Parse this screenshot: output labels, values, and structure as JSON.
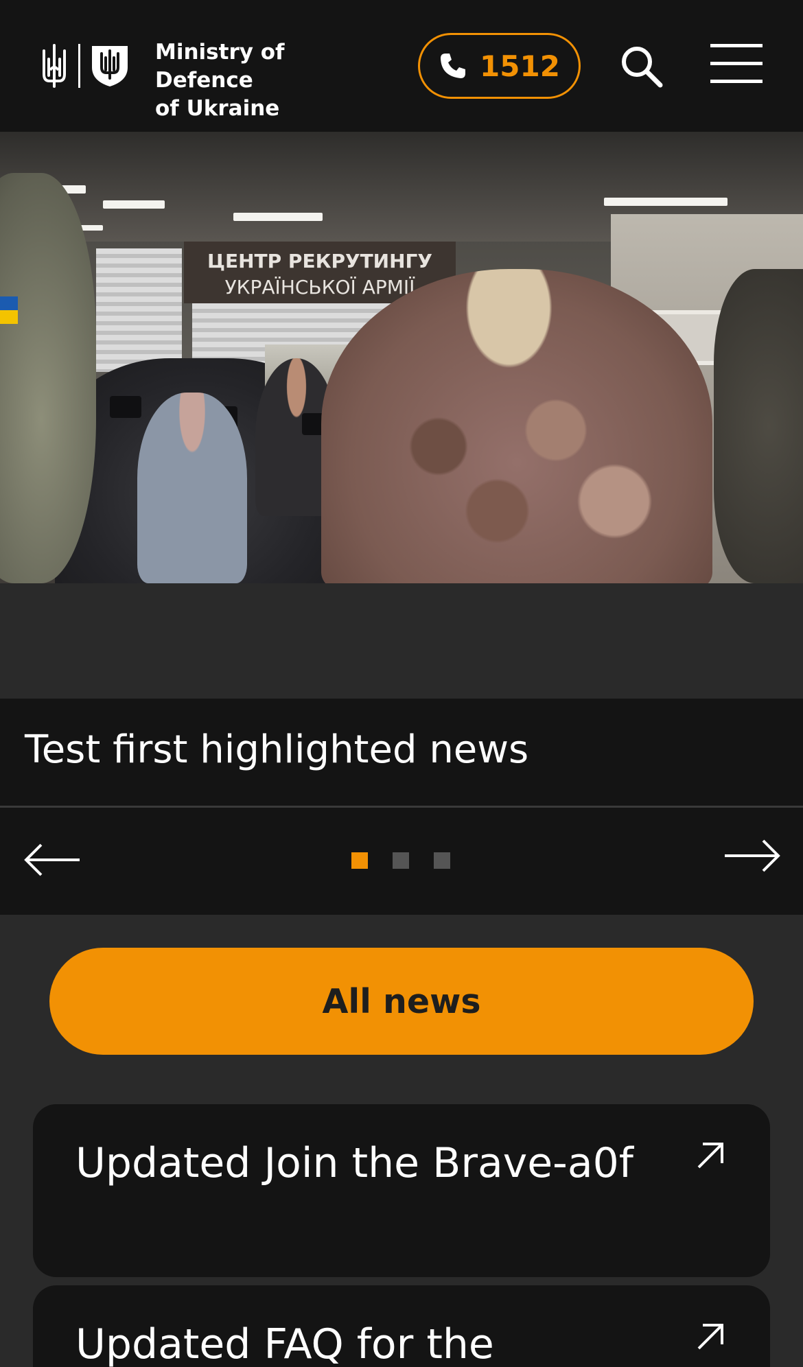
{
  "header": {
    "brand_line1": "Ministry of Defence",
    "brand_line2": "of Ukraine",
    "phone_number": "1512",
    "logo_icons": [
      "trident-icon",
      "shield-icon"
    ]
  },
  "hero": {
    "sign_line1": "ЦЕНТР РЕКРУТИНГУ",
    "sign_line2": "УКРАЇНСЬКОЇ АРМІЇ"
  },
  "slider": {
    "title": "Test first highlighted news",
    "slides_total": 3,
    "active_slide": 1
  },
  "all_news_label": "All news",
  "cards": [
    {
      "title": "Updated Join the Brave-a0f"
    },
    {
      "title": "Updated FAQ for the"
    }
  ],
  "colors": {
    "accent": "#f29104",
    "header_bg": "#141414",
    "page_bg": "#2a2a2a"
  }
}
